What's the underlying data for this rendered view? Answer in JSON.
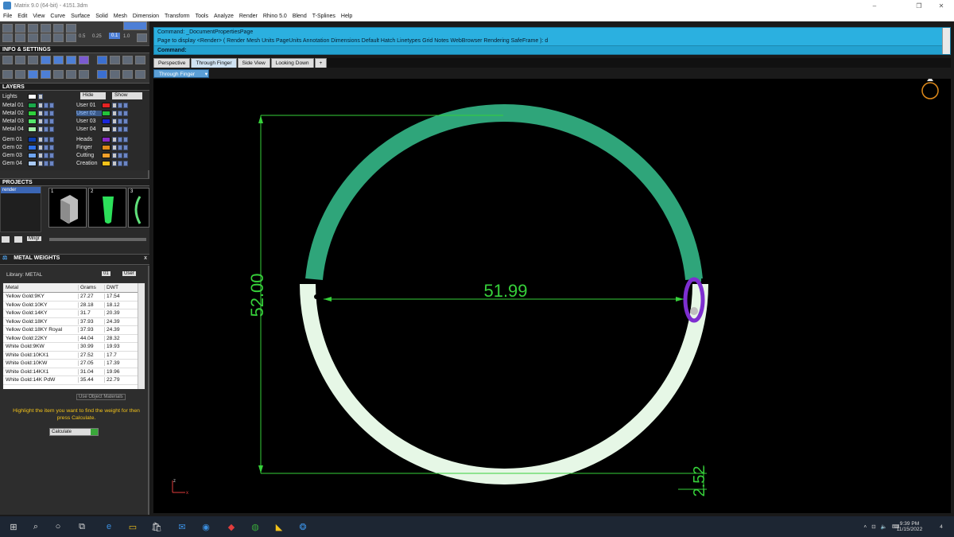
{
  "window": {
    "title": "Matrix 9.0 (64-bit) - 4151.3dm",
    "minimize": "–",
    "maximize": "❐",
    "close": "✕"
  },
  "menu": [
    "File",
    "Edit",
    "View",
    "Curve",
    "Surface",
    "Solid",
    "Mesh",
    "Dimension",
    "Transform",
    "Tools",
    "Analyze",
    "Render",
    "Rhino 5.0",
    "Blend",
    "T-Splines",
    "Help"
  ],
  "left_toolbar": {
    "values": [
      "0.5",
      "0.25",
      "0.1",
      "1.0"
    ]
  },
  "panels": {
    "info_settings": "INFO & SETTINGS",
    "layers": "LAYERS",
    "projects": "PROJECTS",
    "metal_weights": "METAL WEIGHTS",
    "close_x": "x"
  },
  "layers": {
    "lights_label": "Lights",
    "hide_label": "Hide",
    "show_label": "Show",
    "left_column": [
      {
        "name": "Metal 01",
        "color": "#1aa84a"
      },
      {
        "name": "Metal 02",
        "color": "#2fd13c"
      },
      {
        "name": "Metal 03",
        "color": "#52e66a"
      },
      {
        "name": "Metal 04",
        "color": "#a4f2aa"
      },
      {
        "name": "Gem 01",
        "color": "#0d3fb0"
      },
      {
        "name": "Gem 02",
        "color": "#2e6fe6"
      },
      {
        "name": "Gem 03",
        "color": "#6ea4f0"
      },
      {
        "name": "Gem 04",
        "color": "#a9c9f6"
      }
    ],
    "right_column": [
      {
        "name": "User 01",
        "color": "#e52323"
      },
      {
        "name": "User 02",
        "color": "#22c33a"
      },
      {
        "name": "User 03",
        "color": "#1a26d9"
      },
      {
        "name": "User 04",
        "color": "#c9c9c9"
      },
      {
        "name": "Heads",
        "color": "#8a2bc7"
      },
      {
        "name": "Finger",
        "color": "#e08a1a"
      },
      {
        "name": "Cutting",
        "color": "#f2a02a"
      },
      {
        "name": "Creation",
        "color": "#f2c21a"
      }
    ]
  },
  "projects": {
    "items": [
      "render"
    ],
    "thumbnails": [
      "1",
      "2",
      "3"
    ],
    "mngr_label": "Mngr"
  },
  "metal_weights": {
    "library_label": "Library: METAL",
    "tab_01": "01",
    "tab_user": "User",
    "columns": [
      "Metal",
      "Grams",
      "DWT"
    ],
    "rows": [
      [
        "Yellow Gold:9KY",
        "27.27",
        "17.54"
      ],
      [
        "Yellow Gold:10KY",
        "28.18",
        "18.12"
      ],
      [
        "Yellow Gold:14KY",
        "31.7",
        "20.39"
      ],
      [
        "Yellow Gold:18KY",
        "37.93",
        "24.39"
      ],
      [
        "Yellow Gold:18KY Royal",
        "37.93",
        "24.39"
      ],
      [
        "Yellow Gold:22KY",
        "44.04",
        "28.32"
      ],
      [
        "White Gold:9KW",
        "30.99",
        "19.93"
      ],
      [
        "White Gold:10KX1",
        "27.52",
        "17.7"
      ],
      [
        "White Gold:10KW",
        "27.05",
        "17.39"
      ],
      [
        "White Gold:14KX1",
        "31.04",
        "19.96"
      ],
      [
        "White Gold:14K PdW",
        "35.44",
        "22.79"
      ]
    ],
    "use_object_materials": "Use Object Materials",
    "hint": "Highlight the item you want to find the weight for then press Calculate.",
    "calculate_label": "Calculate"
  },
  "command": {
    "line1": "Command: _DocumentPropertiesPage",
    "line2": "Page to display <Render> ( Render  Mesh  Units  PageUnits  Annotation  Dimensions  Default  Hatch  Linetypes  Grid  Notes  WebBrowser  Rendering  SafeFrame ): d",
    "prompt": "Command:"
  },
  "viewport_tabs": [
    "Perspective",
    "Through Finger",
    "Side View",
    "Looking Down",
    "+"
  ],
  "active_tab_index": 1,
  "viewport_label": "Through Finger",
  "dimensions": {
    "inner_diameter": "51.99",
    "height": "52.00",
    "thickness": "2.52"
  },
  "axis": {
    "z": "z",
    "x": "x"
  },
  "colors": {
    "ring_top": "#2fa57a",
    "ring_bottom": "#e6f7e6",
    "dimension_line": "#36d13a",
    "clasp": "#7e2fd0"
  },
  "taskbar": {
    "time": "9:39 PM",
    "date": "11/15/2022",
    "notifications": "4"
  }
}
